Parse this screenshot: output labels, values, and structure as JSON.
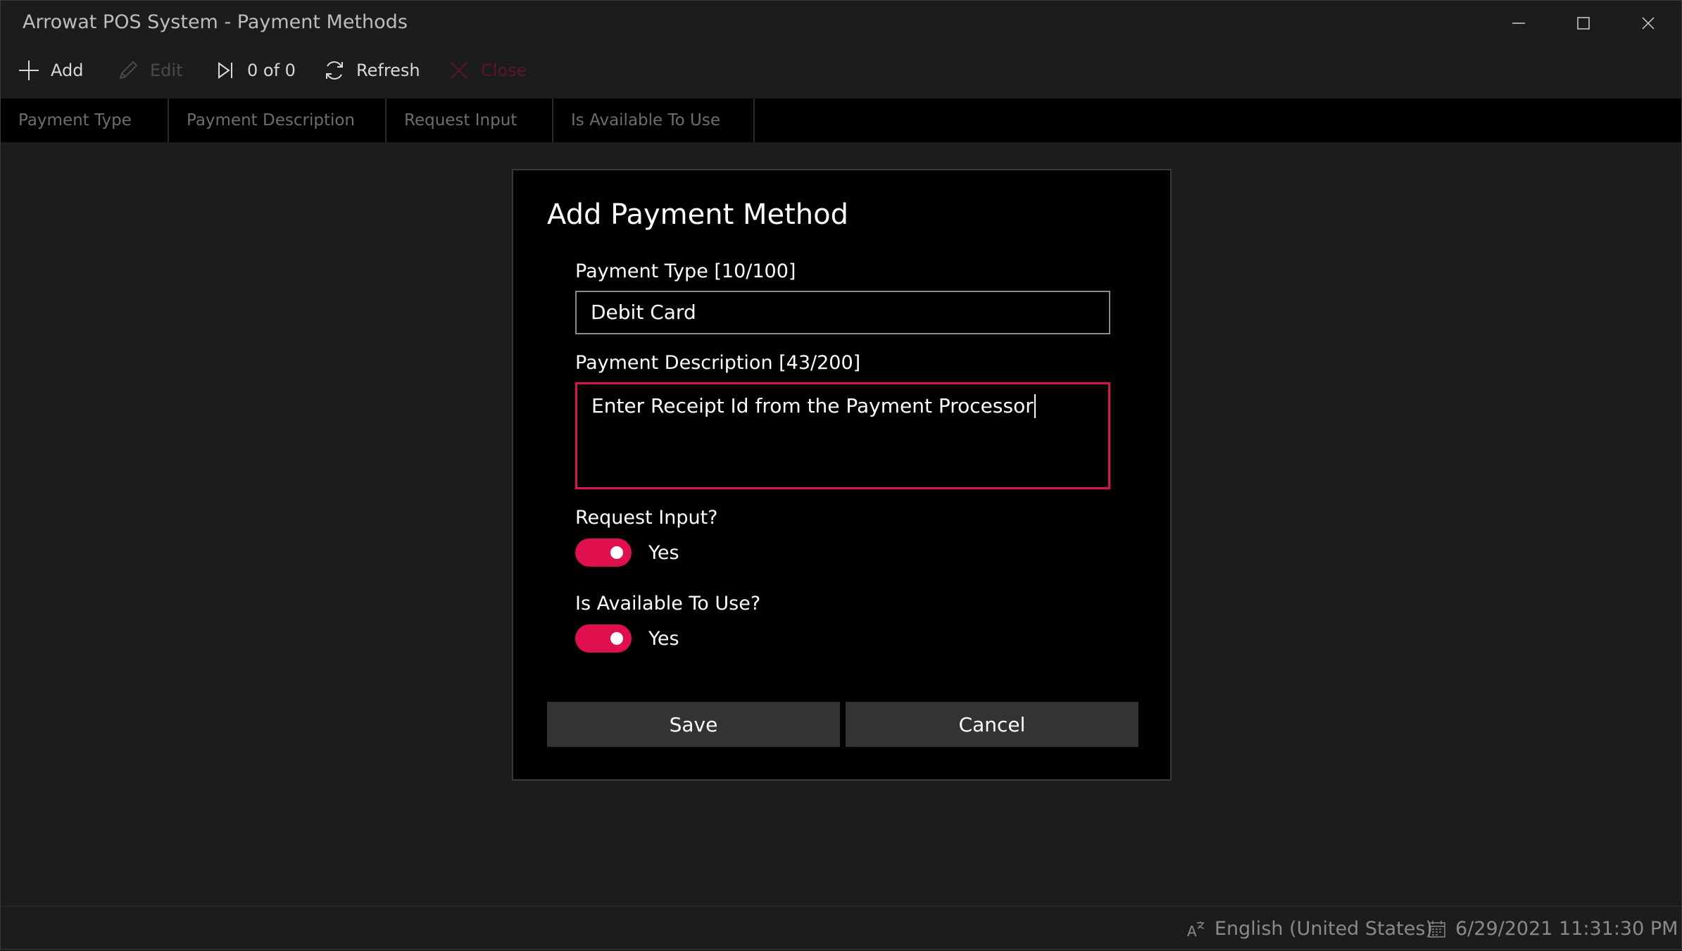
{
  "window": {
    "title": "Arrowat POS System - Payment Methods"
  },
  "toolbar": {
    "add_label": "Add",
    "edit_label": "Edit",
    "record_counter": "0 of 0",
    "refresh_label": "Refresh",
    "close_label": "Close"
  },
  "grid": {
    "columns": [
      "Payment Type",
      "Payment Description",
      "Request Input",
      "Is Available To Use"
    ]
  },
  "dialog": {
    "title": "Add Payment Method",
    "payment_type": {
      "label": "Payment Type [10/100]",
      "value": "Debit Card"
    },
    "payment_description": {
      "label": "Payment Description [43/200]",
      "value": "Enter Receipt Id from the Payment Processor"
    },
    "request_input": {
      "label": "Request Input?",
      "state": "Yes",
      "on": true
    },
    "is_available": {
      "label": "Is Available To Use?",
      "state": "Yes",
      "on": true
    },
    "save_label": "Save",
    "cancel_label": "Cancel"
  },
  "status": {
    "language": "English (United States)",
    "datetime": "6/29/2021 11:31:30 PM"
  },
  "colors": {
    "accent": "#e0104f",
    "background": "#1c1c1c",
    "dialog_background": "#000000",
    "button": "#333333"
  }
}
